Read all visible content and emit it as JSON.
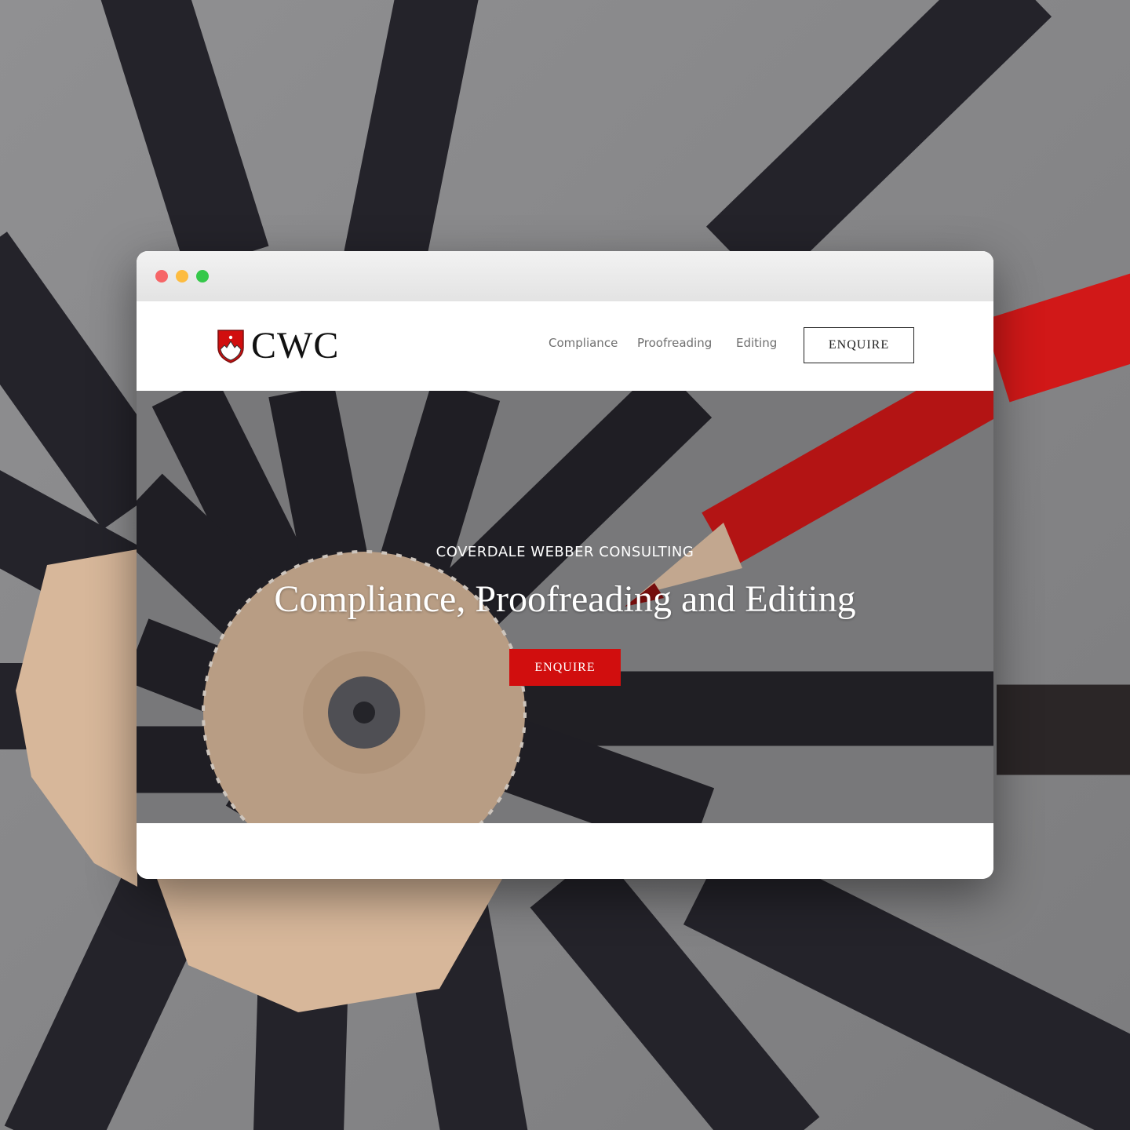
{
  "colors": {
    "accent": "#d10e0e",
    "pencil_black": "#26252b",
    "backdrop_grey": "#8b8b8d",
    "wood": "#d7b79a"
  },
  "window": {
    "traffic_lights": [
      "close-dot",
      "minimize-dot",
      "maximize-dot"
    ]
  },
  "header": {
    "logo_text": "CWC",
    "logo_icon": "shield-icon",
    "nav": [
      "Compliance",
      "Proofreading",
      "Editing"
    ],
    "cta_label": "ENQUIRE"
  },
  "hero": {
    "kicker": "COVERDALE WEBBER CONSULTING",
    "title": "Compliance, Proofreading and Editing",
    "cta_label": "ENQUIRE"
  }
}
